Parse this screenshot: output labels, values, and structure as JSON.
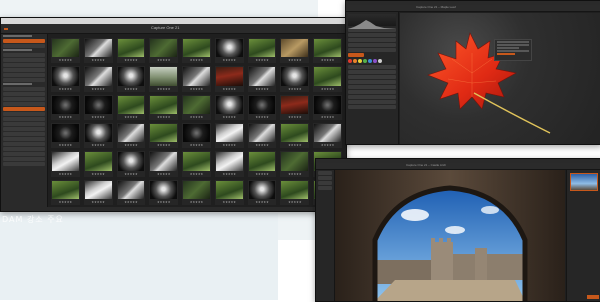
{
  "overlay_text": "DAM 강소 주요",
  "window_browser": {
    "title": "Capture One 21",
    "star_rating": "★★★★★"
  },
  "window_editor": {
    "title": "Capture One 21 – Maple Leaf",
    "swatch_colors": [
      "#e23b2e",
      "#e8822a",
      "#e9d23a",
      "#55b04a",
      "#3d8fd6",
      "#8a4fc9",
      "#cfcfcf"
    ]
  },
  "window_viewer": {
    "title": "Capture One 21 – Castle Arch"
  },
  "colors": {
    "accent": "#c7581b",
    "panel_bg": "#1f1f1f",
    "sidebar_bg": "#2a2a2a"
  }
}
